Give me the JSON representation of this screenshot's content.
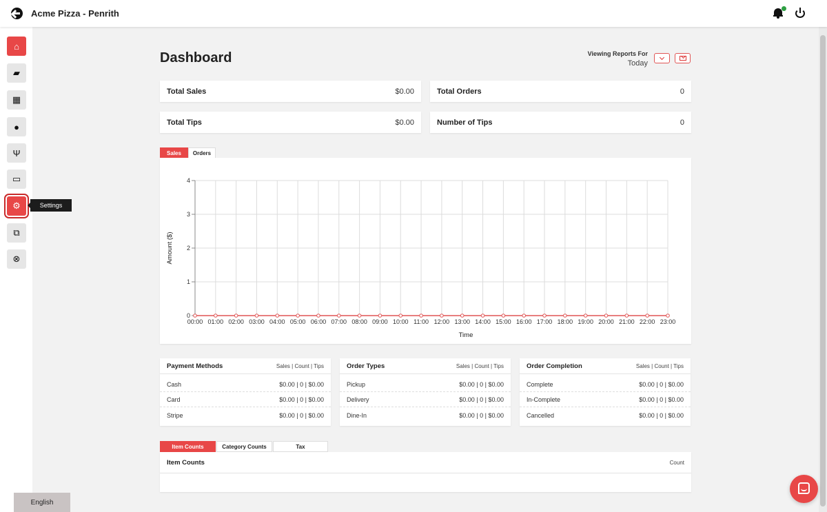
{
  "header": {
    "store_name": "Acme Pizza - Penrith"
  },
  "sidebar": {
    "items": [
      {
        "name": "home",
        "icon": "home-icon",
        "glyph": "⌂"
      },
      {
        "name": "orders",
        "icon": "bag-icon",
        "glyph": "▰"
      },
      {
        "name": "calendar",
        "icon": "calendar-icon",
        "glyph": "▦"
      },
      {
        "name": "customers",
        "icon": "user-icon",
        "glyph": "●"
      },
      {
        "name": "menu",
        "icon": "utensils-icon",
        "glyph": "Ψ"
      },
      {
        "name": "payments",
        "icon": "credit-card-icon",
        "glyph": "▭"
      },
      {
        "name": "settings",
        "icon": "gear-icon",
        "glyph": "⚙"
      },
      {
        "name": "external",
        "icon": "external-link-icon",
        "glyph": "⧉"
      },
      {
        "name": "support",
        "icon": "life-ring-icon",
        "glyph": "⊗"
      }
    ],
    "tooltip": "Settings",
    "language": "English"
  },
  "dashboard": {
    "title": "Dashboard",
    "viewing_label": "Viewing Reports For",
    "viewing_value": "Today",
    "stats": {
      "total_sales_label": "Total Sales",
      "total_sales_value": "$0.00",
      "total_orders_label": "Total Orders",
      "total_orders_value": "0",
      "total_tips_label": "Total Tips",
      "total_tips_value": "$0.00",
      "number_tips_label": "Number of Tips",
      "number_tips_value": "0"
    },
    "chart_tabs": [
      "Sales",
      "Orders"
    ],
    "summaries": [
      {
        "title": "Payment Methods",
        "columns": "Sales | Count | Tips",
        "rows": [
          {
            "label": "Cash",
            "value": "$0.00 | 0 | $0.00"
          },
          {
            "label": "Card",
            "value": "$0.00 | 0 | $0.00"
          },
          {
            "label": "Stripe",
            "value": "$0.00 | 0 | $0.00"
          }
        ]
      },
      {
        "title": "Order Types",
        "columns": "Sales | Count | Tips",
        "rows": [
          {
            "label": "Pickup",
            "value": "$0.00 | 0 | $0.00"
          },
          {
            "label": "Delivery",
            "value": "$0.00 | 0 | $0.00"
          },
          {
            "label": "Dine-In",
            "value": "$0.00 | 0 | $0.00"
          }
        ]
      },
      {
        "title": "Order Completion",
        "columns": "Sales | Count | Tips",
        "rows": [
          {
            "label": "Complete",
            "value": "$0.00 | 0 | $0.00"
          },
          {
            "label": "In-Complete",
            "value": "$0.00 | 0 | $0.00"
          },
          {
            "label": "Cancelled",
            "value": "$0.00 | 0 | $0.00"
          }
        ]
      }
    ],
    "count_tabs": [
      "Item Counts",
      "Category Counts",
      "Tax"
    ],
    "items_table": {
      "title": "Item Counts",
      "column": "Count"
    }
  },
  "colors": {
    "accent": "#e84747",
    "notification": "#2ea043"
  },
  "chart_data": {
    "type": "line",
    "xlabel": "Time",
    "ylabel": "Amount ($)",
    "ylim": [
      0,
      4
    ],
    "yticks": [
      0,
      1,
      2,
      3,
      4
    ],
    "grid": true,
    "categories": [
      "00:00",
      "01:00",
      "02:00",
      "03:00",
      "04:00",
      "05:00",
      "06:00",
      "07:00",
      "08:00",
      "09:00",
      "10:00",
      "11:00",
      "12:00",
      "13:00",
      "14:00",
      "15:00",
      "16:00",
      "17:00",
      "18:00",
      "19:00",
      "20:00",
      "21:00",
      "22:00",
      "23:00"
    ],
    "series": [
      {
        "values": [
          0,
          0,
          0,
          0,
          0,
          0,
          0,
          0,
          0,
          0,
          0,
          0,
          0,
          0,
          0,
          0,
          0,
          0,
          0,
          0,
          0,
          0,
          0,
          0
        ],
        "color": "#e05555"
      }
    ]
  }
}
